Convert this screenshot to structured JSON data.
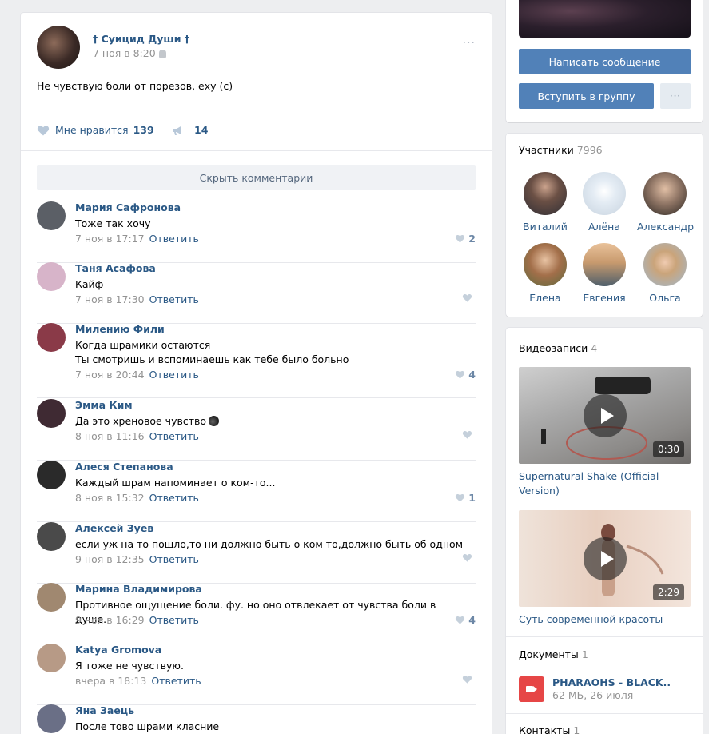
{
  "post": {
    "author": "† Суицид Души †",
    "date": "7 ноя в 8:20",
    "menu": "···",
    "text": "Не чувствую боли от порезов, еху (с)",
    "like_label": "Мне нравится",
    "like_count": "139",
    "share_count": "14",
    "hide_comments": "Скрыть комментарии"
  },
  "comments": [
    {
      "name": "Мария Сафронова",
      "text": "Тоже так хочу",
      "date": "7 ноя в 17:17",
      "reply": "Ответить",
      "likes": "2",
      "avatar": "#5b5f66"
    },
    {
      "name": "Таня Асафова",
      "text": "Кайф",
      "date": "7 ноя в 17:30",
      "reply": "Ответить",
      "likes": "",
      "avatar": "#d7b4c9"
    },
    {
      "name": "Милению Фили",
      "text": "Когда шрамики остаются",
      "text2": "Ты смотришь и вспоминаешь как тебе было больно",
      "date": "7 ноя в 20:44",
      "reply": "Ответить",
      "likes": "4",
      "avatar": "#8a3a48"
    },
    {
      "name": "Эмма Ким",
      "text": "Да это хреновое чувство",
      "date": "8 ноя в 11:16",
      "reply": "Ответить",
      "likes": "",
      "avatar": "#3f2a33"
    },
    {
      "name": "Алеся Степанова",
      "text": "Каждый шрам напоминает о ком-то...",
      "date": "8 ноя в 15:32",
      "reply": "Ответить",
      "likes": "1",
      "avatar": "#2a2a2a"
    },
    {
      "name": "Алексей Зуев",
      "text": "если уж на то пошло,то ни должно быть о ком то,должно быть об одном",
      "date": "9 ноя в 12:35",
      "reply": "Ответить",
      "likes": "",
      "avatar": "#4a4a4a"
    },
    {
      "name": "Марина Владимирова",
      "text": "Противное ощущение боли. фу. но оно отвлекает от чувства боли в душе.",
      "date": "9 ноя в 16:29",
      "reply": "Ответить",
      "likes": "4",
      "avatar": "#a08870"
    },
    {
      "name": "Katya Gromova",
      "text": "Я тоже не чувствую.",
      "date": "вчера в 18:13",
      "reply": "Ответить",
      "likes": "",
      "avatar": "#b79a86"
    },
    {
      "name": "Яна Заець",
      "text": "После тово шрами класние",
      "date": "",
      "reply": "",
      "likes": "",
      "avatar": "#6a6f86"
    }
  ],
  "sidebar": {
    "write_message": "Написать сообщение",
    "join_group": "Вступить в группу",
    "more": "···",
    "members_label": "Участники",
    "members_count": "7996",
    "members": [
      {
        "name": "Виталий",
        "color": "#4d5058"
      },
      {
        "name": "Алёна",
        "color": "#c7d3df"
      },
      {
        "name": "Александр",
        "color": "#6e5d52"
      },
      {
        "name": "Елена",
        "color": "#a36f4a"
      },
      {
        "name": "Евгения",
        "color": "#c89a6e"
      },
      {
        "name": "Ольга",
        "color": "#9fb8cf"
      }
    ],
    "videos_label": "Видеозаписи",
    "videos_count": "4",
    "videos": [
      {
        "title": "Supernatural Shake (Official Version)",
        "duration": "0:30"
      },
      {
        "title": "Суть современной красоты",
        "duration": "2:29"
      }
    ],
    "docs_label": "Документы",
    "docs_count": "1",
    "doc_name": "PHARAOHS - BLACK..",
    "doc_info": "62 МБ, 26 июля",
    "contacts_label": "Контакты",
    "contacts_count": "1"
  },
  "colors": {
    "link": "#2a5885",
    "button": "#5181b8",
    "muted": "#939393",
    "background": "#edeef0"
  }
}
